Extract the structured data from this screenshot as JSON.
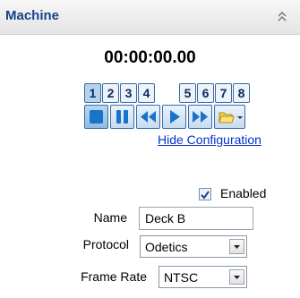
{
  "panel": {
    "title": "Machine"
  },
  "timecode": "00:00:00.00",
  "deck_buttons": [
    "1",
    "2",
    "3",
    "4",
    "5",
    "6",
    "7",
    "8"
  ],
  "transport": {
    "buttons": [
      "stop-icon",
      "pause-icon",
      "rewind-icon",
      "play-icon",
      "fast-forward-icon",
      "open-folder-icon"
    ]
  },
  "config_link": "Hide Configuration",
  "enabled": {
    "label": "Enabled",
    "checked": true
  },
  "fields": {
    "name_label": "Name",
    "name_value": "Deck B",
    "protocol_label": "Protocol",
    "protocol_value": "Odetics",
    "frame_rate_label": "Frame Rate",
    "frame_rate_value": "NTSC"
  },
  "colors": {
    "header_title": "#15428b",
    "link": "#0033cc",
    "accent": "#1a73c8"
  }
}
